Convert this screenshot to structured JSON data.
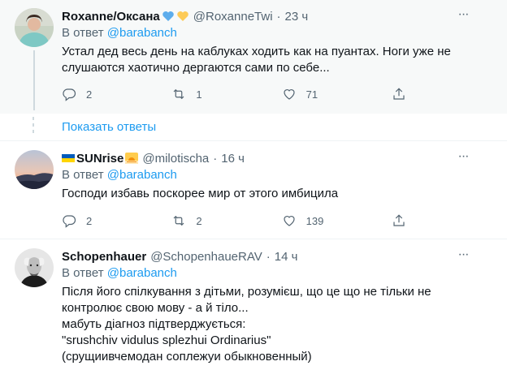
{
  "tweets": [
    {
      "name": "Roxanne/Оксана",
      "badges": [
        "blue-heart",
        "yellow-heart"
      ],
      "handle": "@RoxanneTwi",
      "separator": "·",
      "time": "23 ч",
      "reply_prefix": "В ответ",
      "reply_to": "@barabanch",
      "text_lines": [
        "Устал дед весь день на каблуках ходить как на пуантах. Ноги уже не",
        "слушаются хаотично дергаются сами по себе..."
      ],
      "counts": {
        "replies": "2",
        "retweets": "1",
        "likes": "71"
      }
    },
    {
      "name": "SUNrise",
      "badges": [
        "ukraine-flag",
        "sunrise"
      ],
      "handle": "@milotischa",
      "separator": "·",
      "time": "16 ч",
      "reply_prefix": "В ответ",
      "reply_to": "@barabanch",
      "text_lines": [
        "Господи избавь поскорее мир от этого имбицила"
      ],
      "counts": {
        "replies": "2",
        "retweets": "2",
        "likes": "139"
      }
    },
    {
      "name": "Schopenhauer",
      "badges": [],
      "handle": "@SchopenhaueRAV",
      "separator": "·",
      "time": "14 ч",
      "reply_prefix": "В ответ",
      "reply_to": "@barabanch",
      "text_lines": [
        "Після його спілкування з дітьми, розумієш, що це що не тільки не",
        "контролює свою мову - а й тіло...",
        "мабуть діагноз підтверджується:",
        "\"srushchiv vidulus splezhui Ordinarius\"",
        "(срущиивчемодан соплежуи обыкновенный)"
      ]
    }
  ],
  "show_replies": "Показать ответы",
  "more_glyph": "···",
  "colors": {
    "link": "#1d9bf0",
    "muted": "#536471",
    "highlight_bg": "#f7f9f9"
  }
}
